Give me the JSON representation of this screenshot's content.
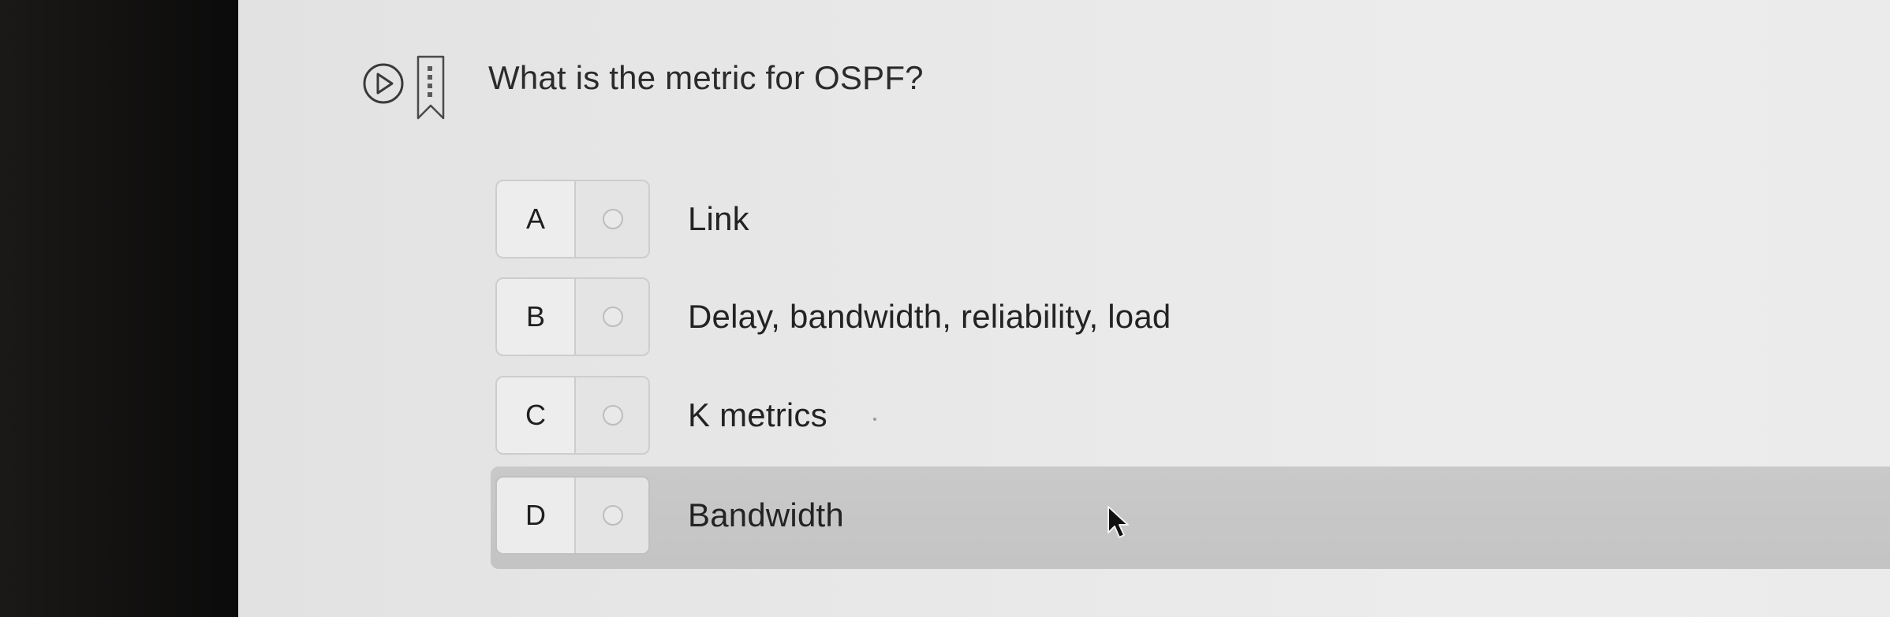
{
  "question": {
    "text": "What is the metric for OSPF?",
    "play_icon": "play-circle-icon",
    "bookmark_icon": "bookmark-icon"
  },
  "options": [
    {
      "letter": "A",
      "text": "Link",
      "selected": false
    },
    {
      "letter": "B",
      "text": "Delay, bandwidth, reliability, load",
      "selected": false
    },
    {
      "letter": "C",
      "text": "K metrics",
      "selected": false
    },
    {
      "letter": "D",
      "text": "Bandwidth",
      "selected": true
    }
  ],
  "cursor_icon": "pointer-arrow-icon",
  "colors": {
    "screen_background": "#e8e8e8",
    "selected_row": "#c6c6c6",
    "text": "#232323"
  }
}
